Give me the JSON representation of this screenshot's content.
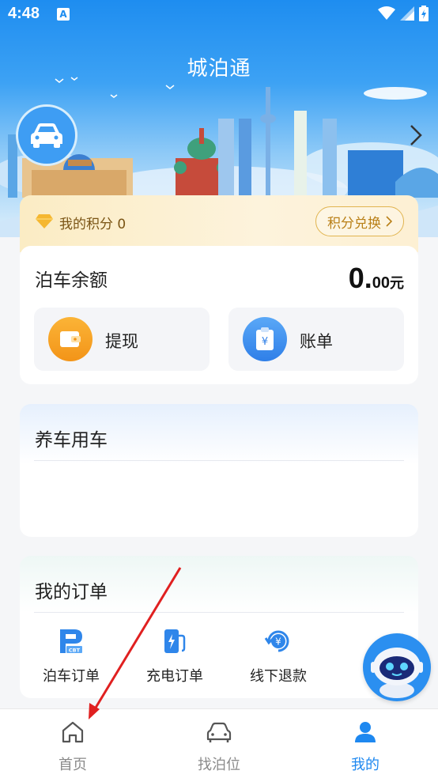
{
  "status_bar": {
    "time": "4:48",
    "notification_letter": "A"
  },
  "header": {
    "title": "城泊通"
  },
  "points": {
    "label": "我的积分 0",
    "exchange_button": "积分兑换"
  },
  "balance": {
    "title": "泊车余额",
    "amount_integer": "0.",
    "amount_decimal": "00",
    "amount_unit": "元",
    "actions": [
      {
        "label": "提现",
        "icon": "wallet-icon",
        "color": "#f7a21b"
      },
      {
        "label": "账单",
        "icon": "bill-icon",
        "color": "#3d8ef2"
      }
    ]
  },
  "car_care": {
    "title": "养车用车"
  },
  "orders": {
    "title": "我的订单",
    "items": [
      {
        "label": "泊车订单",
        "icon": "parking-order-icon"
      },
      {
        "label": "充电订单",
        "icon": "charging-order-icon"
      },
      {
        "label": "线下退款",
        "icon": "refund-icon"
      }
    ]
  },
  "bottom_nav": {
    "items": [
      {
        "label": "首页",
        "icon": "home-icon",
        "active": false
      },
      {
        "label": "找泊位",
        "icon": "car-icon",
        "active": false
      },
      {
        "label": "我的",
        "icon": "user-icon",
        "active": true
      }
    ]
  },
  "colors": {
    "primary": "#1e88f0",
    "gold": "#b98018",
    "annotation_arrow": "#e02020"
  }
}
